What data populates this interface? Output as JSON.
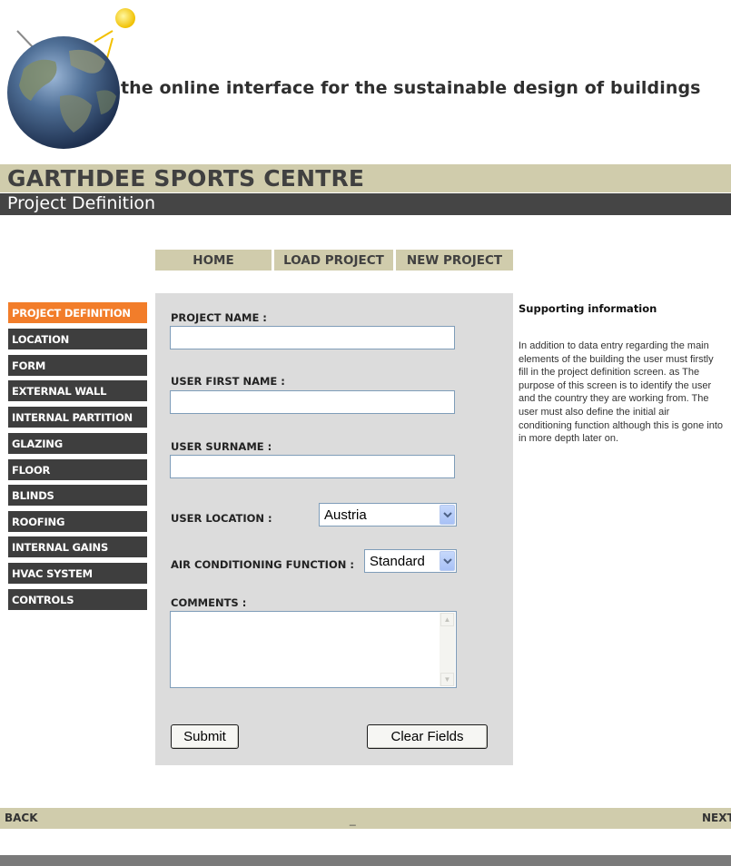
{
  "header": {
    "tagline": "the online interface for the sustainable design of buildings",
    "project_title": "GARTHDEE SPORTS CENTRE",
    "page_subtitle": "Project Definition"
  },
  "topnav": {
    "home": "HOME",
    "load_project": "LOAD PROJECT",
    "new_project": "NEW PROJECT"
  },
  "sidenav": {
    "active_color": "#f27d2a",
    "items": [
      {
        "label": "PROJECT DEFINITION",
        "active": true
      },
      {
        "label": "LOCATION"
      },
      {
        "label": "FORM"
      },
      {
        "label": "EXTERNAL WALL"
      },
      {
        "label": "INTERNAL PARTITION"
      },
      {
        "label": "GLAZING"
      },
      {
        "label": "FLOOR"
      },
      {
        "label": "BLINDS"
      },
      {
        "label": "ROOFING"
      },
      {
        "label": "INTERNAL GAINS"
      },
      {
        "label": "HVAC SYSTEM"
      },
      {
        "label": "CONTROLS"
      }
    ]
  },
  "form": {
    "project_name_label": "PROJECT NAME :",
    "project_name_value": "",
    "first_name_label": "USER FIRST NAME :",
    "first_name_value": "",
    "surname_label": "USER SURNAME :",
    "surname_value": "",
    "location_label": "USER LOCATION :",
    "location_value": "Austria",
    "ac_label": "AIR CONDITIONING FUNCTION :",
    "ac_value": "Standard",
    "comments_label": "COMMENTS :",
    "comments_value": "",
    "submit_label": "Submit",
    "clear_label": "Clear Fields"
  },
  "info": {
    "title": "Supporting information",
    "body": "In addition to data entry regarding the main elements of the building the user must firstly fill in the project definition screen. as The purpose of this screen is to identify the user and the country they are working from. The user must also define the initial air conditioning function although this is gone into in more depth later on."
  },
  "bottom": {
    "back": "BACK",
    "separator": "_",
    "next": "NEXT"
  }
}
